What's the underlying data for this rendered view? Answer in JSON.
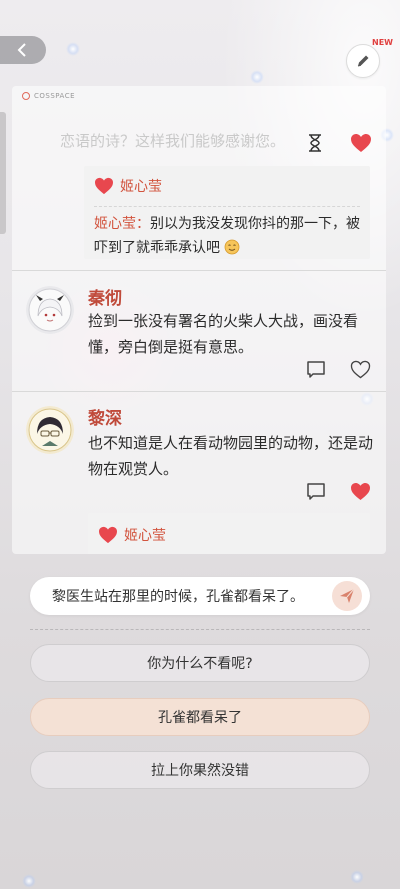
{
  "header": {
    "back_icon": "chevron-left-icon",
    "edit_icon": "pencil-icon",
    "new_badge": "NEW"
  },
  "brand": "COSSPACE",
  "post": {
    "faded_line": "恋语的诗？这样我们能够感谢您。"
  },
  "colors": {
    "accent_red": "#e8474e",
    "name_red": "#c04a3a",
    "selected_option": "#f4e1d5"
  },
  "likes_block": {
    "liker": "姬心莹",
    "reply_author": "姬心莹：",
    "reply_text": "别以为我没发现你抖的那一下，被吓到了就乖乖承认吧",
    "emoji": "smile-emoji"
  },
  "comments": [
    {
      "name": "秦彻",
      "text": "捡到一张没有署名的火柴人大战，画没看懂，旁白倒是挺有意思。",
      "liked": false
    },
    {
      "name": "黎深",
      "text": "也不知道是人在看动物园里的动物，还是动物在观赏人。",
      "liked": true,
      "liker": "姬心莹"
    }
  ],
  "input": {
    "value": "黎医生站在那里的时候，孔雀都看呆了。"
  },
  "options": [
    {
      "label": "你为什么不看呢?"
    },
    {
      "label": "孔雀都看呆了",
      "selected": true
    },
    {
      "label": "拉上你果然没错"
    }
  ]
}
